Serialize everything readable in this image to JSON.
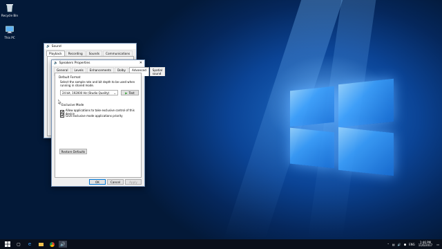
{
  "desktop": {
    "icons": [
      {
        "label": "Recycle Bin",
        "icon": "recycle-bin-icon"
      },
      {
        "label": "This PC",
        "icon": "computer-icon"
      }
    ]
  },
  "sound_window": {
    "title": "Sound",
    "tabs": [
      "Playback",
      "Recording",
      "Sounds",
      "Communications"
    ]
  },
  "props_window": {
    "title": "Speakers Properties",
    "tabs": [
      "General",
      "Levels",
      "Enhancements",
      "Dolby",
      "Advanced",
      "Spatial sound"
    ],
    "active_tab": "Advanced",
    "default_format": {
      "group_label": "Default Format",
      "description": "Select the sample rate and bit depth to be used when running in shared mode.",
      "selected": "24 bit, 192000 Hz (Studio Quality)",
      "test_label": "Test"
    },
    "exclusive": {
      "group_label": "Exclusive Mode",
      "allow_label": "Allow applications to take exclusive control of this device",
      "priority_label": "Give exclusive mode applications priority"
    },
    "restore_label": "Restore Defaults",
    "ok_label": "OK",
    "cancel_label": "Cancel",
    "apply_label": "Apply"
  },
  "taskbar": {
    "language": "ENG",
    "time": "1:46 PM",
    "date": "11/6/2017"
  },
  "colors": {
    "accent": "#0078d7",
    "taskbar": "#0a0f1a"
  }
}
